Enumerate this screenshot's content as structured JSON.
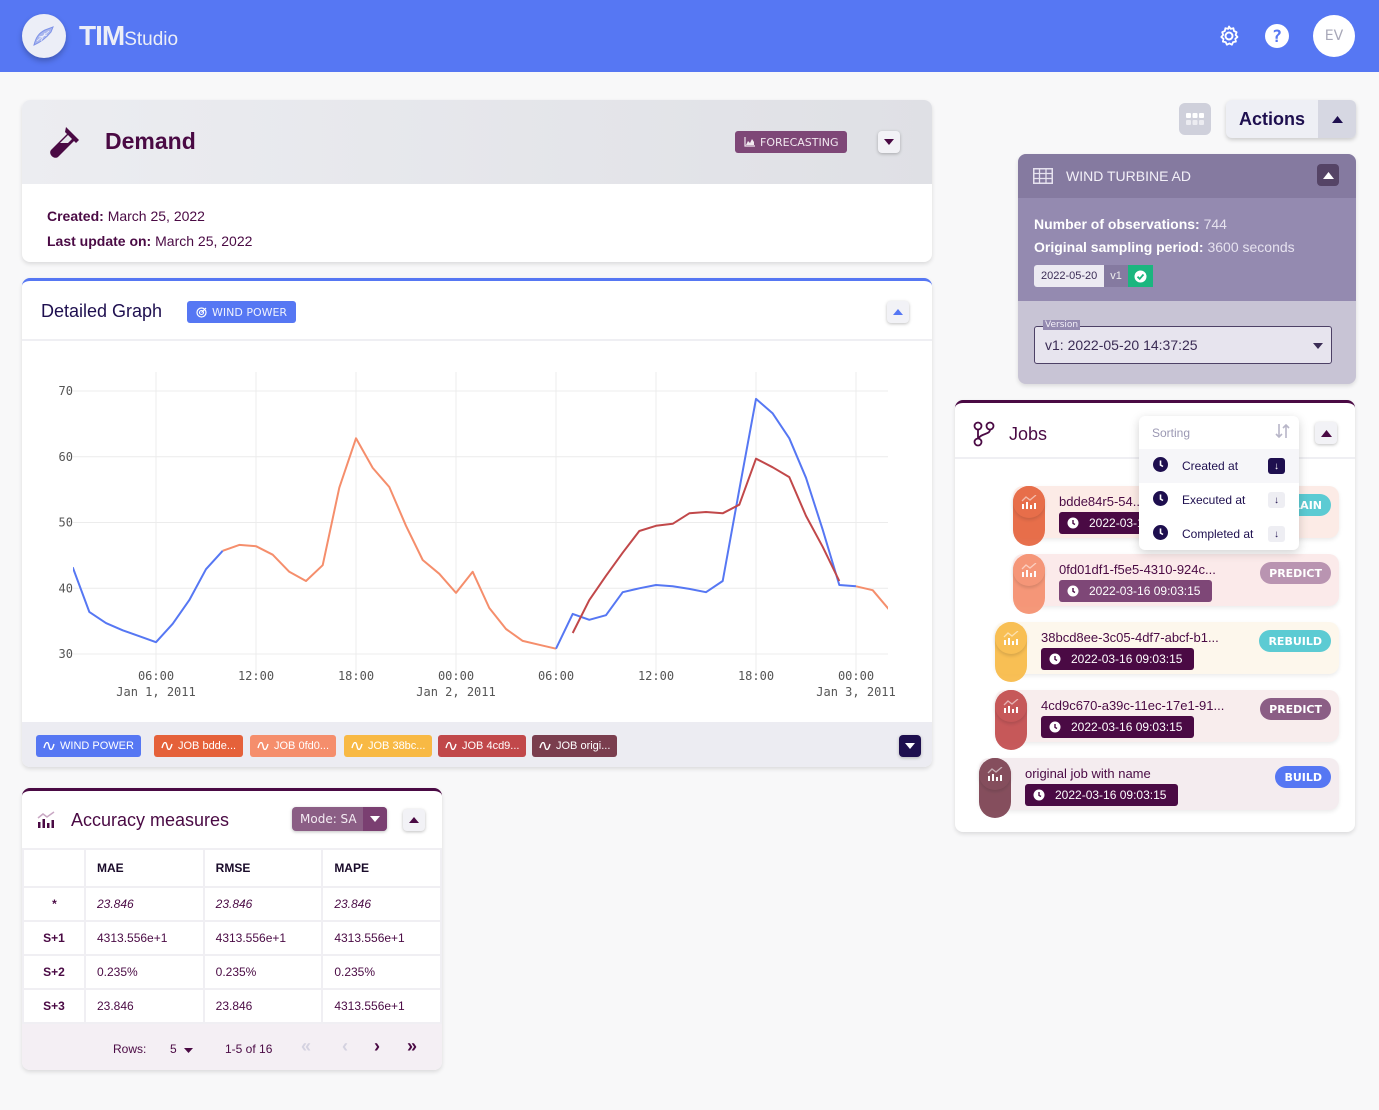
{
  "app": {
    "brand_bold": "TIM",
    "brand_light": "Studio",
    "user_initials": "EV"
  },
  "icons": {
    "settings": "gear-icon",
    "help": "question-icon",
    "logo": "tim-logo-icon"
  },
  "demand": {
    "title": "Demand",
    "badge": "FORECASTING",
    "created_label": "Created:",
    "created_value": "March 25, 2022",
    "updated_label": "Last update on:",
    "updated_value": "March 25, 2022"
  },
  "graph": {
    "title": "Detailed Graph",
    "badge": "WIND POWER",
    "legend": [
      {
        "label": "WIND POWER",
        "color": "#5677f3"
      },
      {
        "label": "JOB bdde...",
        "color": "#e5613a"
      },
      {
        "label": "JOB 0fd0...",
        "color": "#f58e6c"
      },
      {
        "label": "JOB 38bc...",
        "color": "#f8b944"
      },
      {
        "label": "JOB 4cd9...",
        "color": "#c1484a"
      },
      {
        "label": "JOB origi...",
        "color": "#7a3e4e"
      }
    ]
  },
  "chart_data": {
    "type": "line",
    "title": "",
    "xlabel": "",
    "ylabel": "",
    "x_unit": "hours since Jan 1, 2011 00:00",
    "xlim": [
      0.5,
      51
    ],
    "ylim": [
      28.5,
      71.5
    ],
    "yticks": [
      30,
      40,
      50,
      60,
      70
    ],
    "xticks": [
      {
        "h": 6,
        "label": "06:00",
        "sub": "Jan 1, 2011"
      },
      {
        "h": 12,
        "label": "12:00",
        "sub": ""
      },
      {
        "h": 18,
        "label": "18:00",
        "sub": ""
      },
      {
        "h": 24,
        "label": "00:00",
        "sub": "Jan 2, 2011"
      },
      {
        "h": 30,
        "label": "06:00",
        "sub": ""
      },
      {
        "h": 36,
        "label": "12:00",
        "sub": ""
      },
      {
        "h": 42,
        "label": "18:00",
        "sub": ""
      },
      {
        "h": 48,
        "label": "00:00",
        "sub": "Jan 3, 2011"
      }
    ],
    "grid": true,
    "series": [
      {
        "name": "WIND POWER",
        "color": "#5677f3",
        "x": [
          1,
          2,
          3,
          4,
          5,
          6,
          7,
          8,
          9,
          10
        ],
        "values": [
          43.2,
          36.4,
          34.7,
          33.6,
          32.7,
          31.8,
          34.6,
          38.2,
          42.9,
          45.7
        ]
      },
      {
        "name": "JOB 0fd0 (predict)",
        "color": "#f58e6c",
        "x": [
          10,
          11,
          12,
          13,
          14,
          15,
          16,
          17,
          18,
          19,
          20,
          21,
          22,
          23,
          24,
          25,
          26,
          27,
          28,
          29,
          30
        ],
        "values": [
          45.7,
          46.6,
          46.4,
          45.1,
          42.5,
          41.1,
          43.5,
          55.3,
          62.8,
          58.3,
          55.4,
          49.5,
          44.3,
          42.2,
          39.3,
          42.5,
          37.0,
          33.8,
          32.0,
          31.4,
          30.8
        ]
      },
      {
        "name": "WIND POWER (cont.)",
        "color": "#5677f3",
        "x": [
          30,
          31,
          32,
          33,
          34,
          35,
          36,
          37,
          38,
          39,
          40,
          41,
          42,
          43,
          44,
          45,
          46,
          47,
          48
        ],
        "values": [
          30.8,
          36.1,
          35.2,
          35.9,
          39.4,
          40.0,
          40.5,
          40.3,
          39.9,
          39.4,
          41.1,
          55.0,
          68.8,
          66.6,
          62.8,
          56.8,
          48.9,
          40.5,
          40.3
        ]
      },
      {
        "name": "JOB 4cd9",
        "color": "#c1484a",
        "x": [
          31,
          32,
          33,
          34,
          35,
          36,
          37,
          38,
          39,
          40,
          41,
          42,
          43,
          44,
          45,
          46,
          47
        ],
        "values": [
          33.2,
          38.2,
          41.9,
          45.4,
          48.7,
          49.5,
          49.8,
          51.4,
          51.6,
          51.4,
          52.7,
          59.7,
          58.4,
          56.9,
          51.0,
          46.3,
          41.1
        ]
      },
      {
        "name": "JOB 0fd0 (tail)",
        "color": "#f58e6c",
        "x": [
          48,
          49,
          50,
          51
        ],
        "values": [
          40.3,
          39.7,
          36.7,
          36.7
        ]
      }
    ]
  },
  "accuracy": {
    "title": "Accuracy measures",
    "mode_label": "Mode: SA",
    "columns": [
      "",
      "MAE",
      "RMSE",
      "MAPE"
    ],
    "rows": [
      {
        "h": "*",
        "mae": "23.846",
        "rmse": "23.846",
        "mape": "23.846"
      },
      {
        "h": "S+1",
        "mae": "4313.556e+1",
        "rmse": "4313.556e+1",
        "mape": "4313.556e+1"
      },
      {
        "h": "S+2",
        "mae": "0.235%",
        "rmse": "0.235%",
        "mape": "0.235%"
      },
      {
        "h": "S+3",
        "mae": "23.846",
        "rmse": "23.846",
        "mape": "4313.556e+1"
      }
    ],
    "rows_label": "Rows:",
    "rows_value": "5",
    "range": "1-5 of 16"
  },
  "actions": {
    "label": "Actions"
  },
  "dataset": {
    "title": "WIND TURBINE AD",
    "obs_label": "Number of observations:",
    "obs_value": "744",
    "period_label": "Original sampling period:",
    "period_value": "3600 seconds",
    "version_date": "2022-05-20",
    "version_tag": "v1",
    "version_field_label": "Version",
    "version_selected": "v1: 2022-05-20 14:37:25"
  },
  "jobs": {
    "title": "Jobs",
    "sorting": {
      "label": "Sorting",
      "options": [
        {
          "label": "Created at",
          "active": true
        },
        {
          "label": "Executed at",
          "active": false
        },
        {
          "label": "Completed at",
          "active": false
        }
      ]
    },
    "items": [
      {
        "name": "bdde84r5-54...",
        "time": "2022-03-16 09:03:15",
        "tag": "TRAIN",
        "color": "#e5613a",
        "bg": "#fcebe6",
        "timebg": "#4a0a44",
        "tagbg": "#5ccbd3"
      },
      {
        "name": "0fd01df1-f5e5-4310-924c...",
        "time": "2022-03-16 09:03:15",
        "tag": "PREDICT",
        "color": "#f58e6c",
        "bg": "#fbeaea",
        "timebg": "#7e4777",
        "tagbg": "#b994b1"
      },
      {
        "name": "38bcd8ee-3c05-4df7-abcf-b1...",
        "time": "2022-03-16 09:03:15",
        "tag": "REBUILD",
        "color": "#f8b944",
        "bg": "#fdf7ec",
        "timebg": "#4a0a44",
        "tagbg": "#5ccbd3"
      },
      {
        "name": "4cd9c670-a39c-11ec-17e1-91...",
        "time": "2022-03-16 09:03:15",
        "tag": "PREDICT",
        "color": "#c1484a",
        "bg": "#f8eded",
        "timebg": "#4a0a44",
        "tagbg": "#8b5e85"
      },
      {
        "name": "original job with name",
        "time": "2022-03-16 09:03:15",
        "tag": "BUILD",
        "color": "#7a3e4e",
        "bg": "#f4ecef",
        "timebg": "#4a0a44",
        "tagbg": "#5677f3"
      }
    ]
  }
}
